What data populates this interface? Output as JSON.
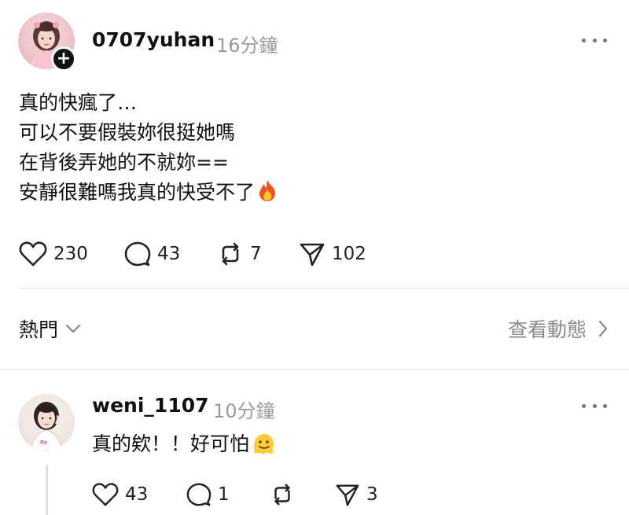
{
  "post": {
    "username": "0707yuhan",
    "time": "16分鐘",
    "body_lines": [
      "真的快瘋了…",
      "可以不要假裝妳很挺她嗎",
      "在背後弄她的不就妳==",
      "安靜很難嗎我真的快受不了"
    ],
    "likes": "230",
    "comments": "43",
    "reposts": "7",
    "shares": "102"
  },
  "sort": {
    "label": "熱門",
    "view_activity": "查看動態"
  },
  "reply": {
    "username": "weni_1107",
    "time": "10分鐘",
    "text": "真的欸！！好可怕",
    "likes": "43",
    "comments": "1",
    "reposts": "",
    "shares": "3"
  },
  "colors": {
    "text": "#111111",
    "muted": "#9a9a9a",
    "divider": "#e4e4e4"
  },
  "icons": [
    "heart-icon",
    "comment-icon",
    "repost-icon",
    "share-icon",
    "more-icon",
    "chevron-down-icon",
    "chevron-right-icon",
    "fire-emoji",
    "melting-face-emoji",
    "plus-icon"
  ]
}
